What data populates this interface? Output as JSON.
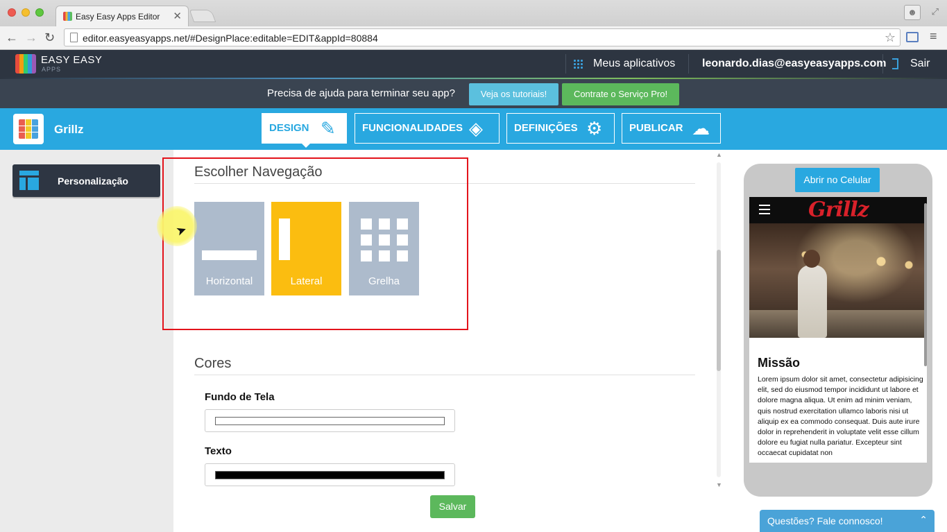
{
  "browser": {
    "tab_title": "Easy Easy Apps Editor",
    "tab_close": "✕",
    "url": "editor.easyeasyapps.net/#DesignPlace:editable=EDIT&appId=80884",
    "icons": [
      "back-arrow-icon",
      "forward-arrow-icon",
      "reload-icon",
      "page-icon",
      "bookmark-star-icon",
      "cast-icon",
      "menu-icon",
      "profile-icon",
      "expand-icon"
    ]
  },
  "header": {
    "logo_text": "EASY EASY",
    "logo_sub": "APPS",
    "my_apps": "Meus aplicativos",
    "user_email": "leonardo.dias@easyeasyapps.com",
    "logout": "Sair"
  },
  "help_bar": {
    "text": "Precisa de ajuda para terminar seu app?",
    "tutorials_button": "Veja os tutoriais!",
    "pro_button": "Contrate o Serviço Pro!"
  },
  "app_nav": {
    "app_name": "Grillz",
    "tabs": [
      {
        "label": "DESIGN",
        "icon": "brush-icon",
        "active": true
      },
      {
        "label": "FUNCIONALIDADES",
        "icon": "tag-icon",
        "active": false
      },
      {
        "label": "DEFINIÇÕES",
        "icon": "gear-icon",
        "active": false
      },
      {
        "label": "PUBLICAR",
        "icon": "cloud-upload-icon",
        "active": false
      }
    ]
  },
  "sidebar": {
    "items": [
      {
        "label": "Personalização",
        "icon": "layout-icon",
        "active": true
      }
    ]
  },
  "navigation_section": {
    "title": "Escolher Navegação",
    "options": [
      {
        "label": "Horizontal",
        "selected": false
      },
      {
        "label": "Lateral",
        "selected": true
      },
      {
        "label": "Grelha",
        "selected": false
      }
    ]
  },
  "colors_section": {
    "title": "Cores",
    "background_label": "Fundo de Tela",
    "background_color": "#ffffff",
    "text_label": "Texto",
    "text_color": "#000000",
    "save_button": "Salvar"
  },
  "preview": {
    "open_mobile_button": "Abrir no Celular",
    "brand": "Grillz",
    "heading": "Missão",
    "body": "Lorem ipsum dolor sit amet, consectetur adipisicing elit, sed do eiusmod tempor incididunt ut labore et dolore magna aliqua. Ut enim ad minim veniam, quis nostrud exercitation ullamco laboris nisi ut aliquip ex ea commodo consequat. Duis aute irure dolor in reprehenderit in voluptate velit esse cillum dolore eu fugiat nulla pariatur. Excepteur sint occaecat cupidatat non"
  },
  "chat": {
    "label": "Questões? Fale connosco!"
  },
  "colors": {
    "header_dark": "#2d3541",
    "accent_blue": "#29a8e0",
    "selected_yellow": "#fbbd10",
    "option_grey": "#adbbcc",
    "success_green": "#5cb85c",
    "highlight_red": "#e3131b"
  }
}
